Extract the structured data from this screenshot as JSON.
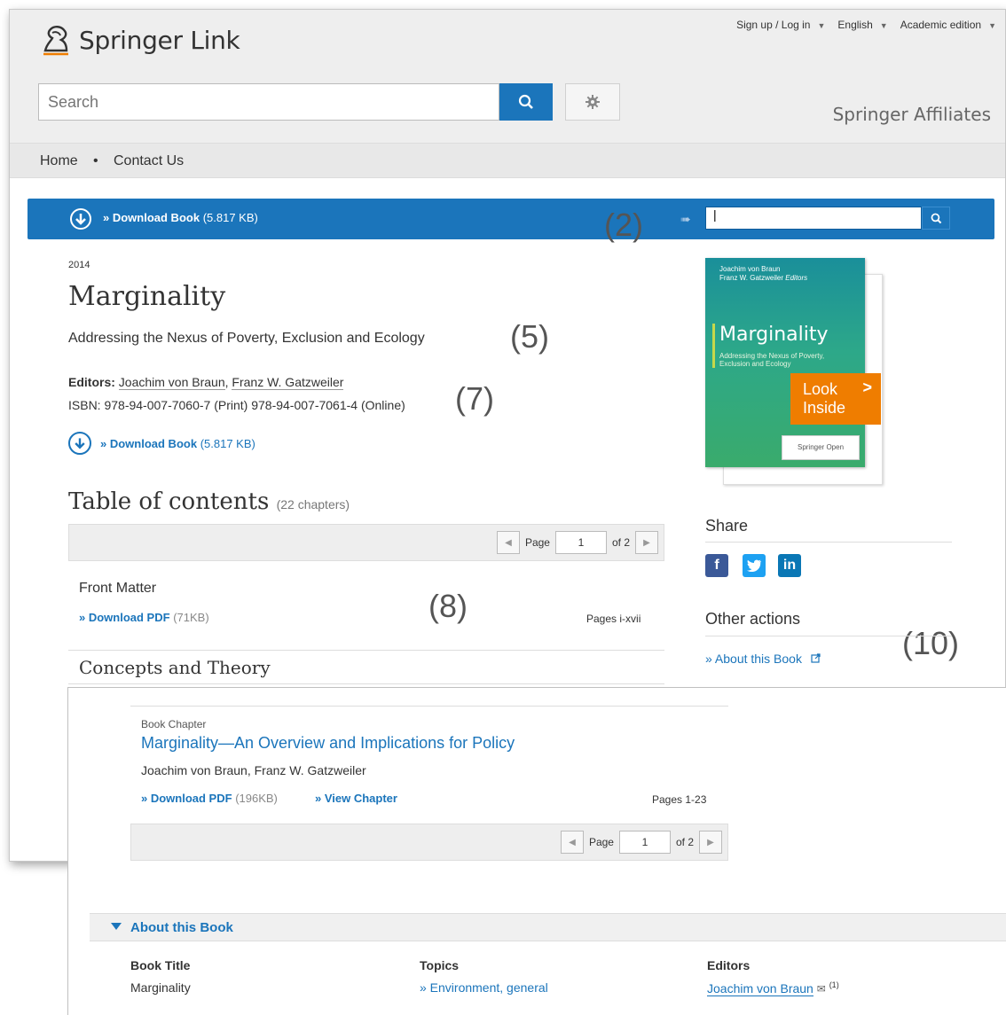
{
  "header": {
    "logo_brand": "Springer",
    "logo_product": "Link",
    "top_menu": [
      {
        "label": "Sign up / Log in"
      },
      {
        "label": "English"
      },
      {
        "label": "Academic edition"
      }
    ],
    "search_placeholder": "Search",
    "affiliates": "Springer Affiliates"
  },
  "nav": {
    "home": "Home",
    "separator": "•",
    "contact": "Contact Us"
  },
  "download_bar": {
    "label": "» Download Book",
    "size": "(5.817 KB)",
    "arrow_glyph": "➠",
    "find_value": "|"
  },
  "callouts": {
    "c2": "(2)",
    "c5": "(5)",
    "c7": "(7)",
    "c8": "(8)",
    "c10": "(10)"
  },
  "book": {
    "year": "2014",
    "title": "Marginality",
    "subtitle": "Addressing the Nexus of Poverty, Exclusion and Ecology",
    "editors_label": "Editors:",
    "editor1": "Joachim von Braun",
    "editor_sep": ",",
    "editor2": "Franz W. Gatzweiler",
    "isbn": "ISBN: 978-94-007-7060-7 (Print) 978-94-007-7061-4 (Online)",
    "download_label": "» Download Book",
    "download_size": "(5.817 KB)"
  },
  "toc": {
    "title": "Table of contents",
    "count": "(22 chapters)",
    "pager": {
      "page_label": "Page",
      "page_value": "1",
      "of_label": "of 2"
    },
    "front_matter": {
      "title": "Front Matter",
      "download": "» Download PDF",
      "size": "(71KB)",
      "pages": "Pages i-xvii"
    },
    "section": "Concepts and Theory"
  },
  "cover": {
    "editors_line1": "Joachim von Braun",
    "editors_line2": "Franz W. Gatzweiler",
    "editors_suffix": "Editors",
    "title": "Marginality",
    "subtitle_line1": "Addressing the Nexus of Poverty,",
    "subtitle_line2": "Exclusion and Ecology",
    "publisher": "Springer Open",
    "look_inside_line1": "Look",
    "look_inside_line2": "Inside"
  },
  "sidebar": {
    "share_heading": "Share",
    "social": [
      {
        "label": "f",
        "icon": "facebook-icon",
        "color": "#3b5998"
      },
      {
        "label": "t",
        "icon": "twitter-icon",
        "color": "#1da1f2"
      },
      {
        "label": "in",
        "icon": "linkedin-icon",
        "color": "#0a77b5"
      }
    ],
    "other_heading": "Other actions",
    "about_link": "» About this Book"
  },
  "chapter": {
    "type_label": "Book Chapter",
    "title": "Marginality—An Overview and Implications for Policy",
    "authors": "Joachim von Braun, Franz W. Gatzweiler",
    "download": "» Download PDF",
    "size": "(196KB)",
    "view": "» View Chapter",
    "pages": "Pages 1-23",
    "pager": {
      "page_label": "Page",
      "page_value": "1",
      "of_label": "of 2"
    }
  },
  "about_section": {
    "label": "About this Book",
    "book_title_heading": "Book Title",
    "book_title_value": "Marginality",
    "topics_heading": "Topics",
    "topics_value": "» Environment, general",
    "editors_heading": "Editors",
    "editors_value": "Joachim von Braun",
    "editors_sup": "(1)"
  },
  "colors": {
    "accent": "#1b75bb",
    "orange": "#ef7d00",
    "header_bg": "#eeeeee"
  }
}
